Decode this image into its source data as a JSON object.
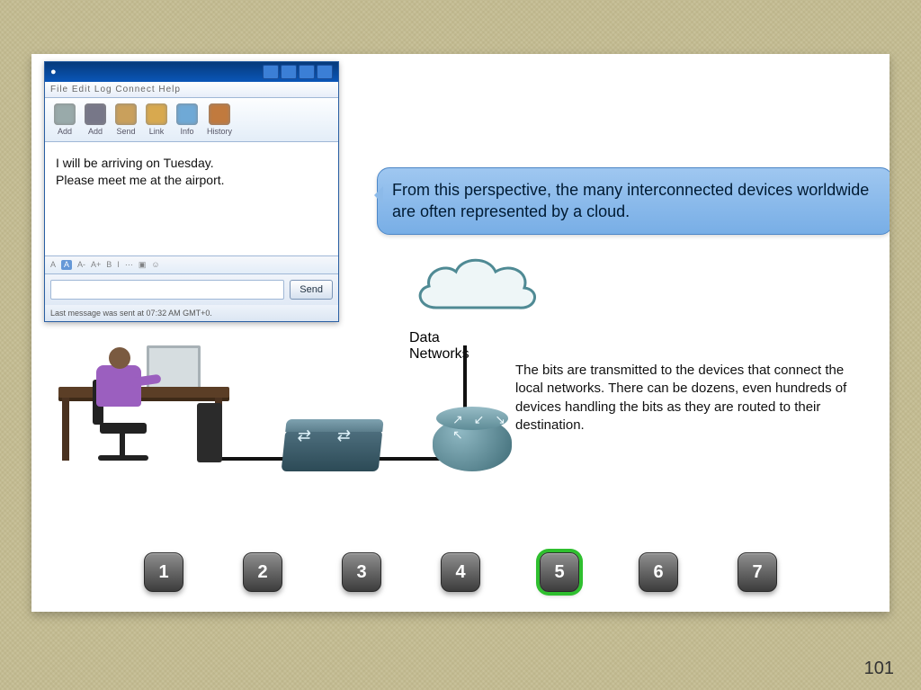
{
  "page_number": "101",
  "chat": {
    "menu_text": "File  Edit  Log  Connect  Help",
    "toolbar": [
      "Add",
      "Add",
      "Send",
      "Link",
      "Info",
      "History"
    ],
    "message_line1": "I will be arriving on Tuesday.",
    "message_line2": "Please meet me at the airport.",
    "send_label": "Send",
    "status_text": "Last message was sent at 07:32 AM  GMT+0."
  },
  "bubble_text": "From this perspective, the many interconnected devices worldwide are often represented by a cloud.",
  "cloud_label_line1": "Data",
  "cloud_label_line2": "Networks",
  "explain_text": "The bits are transmitted to the devices that connect the local networks. There can be dozens, even hundreds of devices handling the bits as they are routed to their destination.",
  "steps": {
    "labels": [
      "1",
      "2",
      "3",
      "4",
      "5",
      "6",
      "7"
    ],
    "active_index": 4
  }
}
